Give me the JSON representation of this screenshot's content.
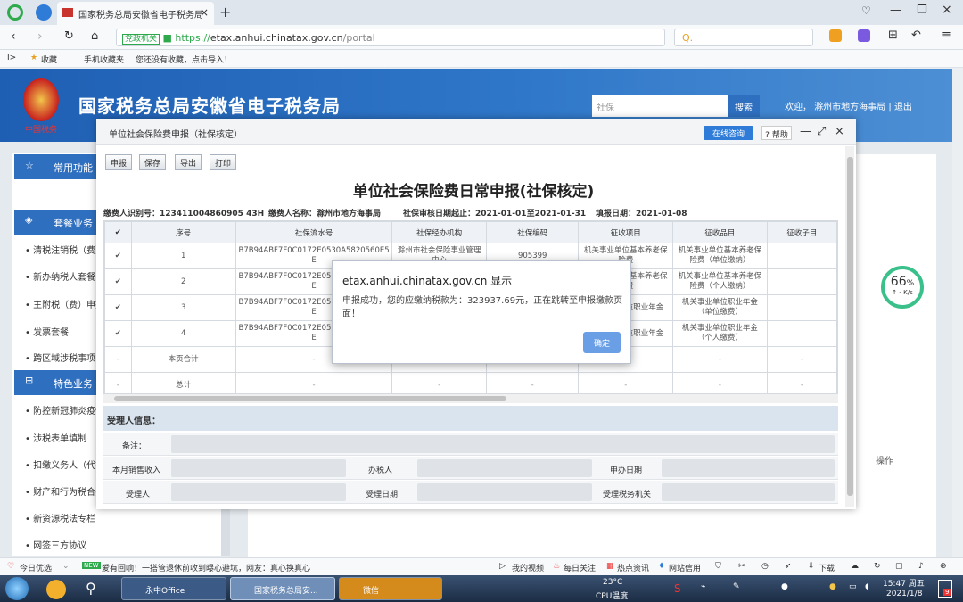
{
  "browser": {
    "tab_title": "国家税务总局安徽省电子税务局",
    "badge": "党政机关",
    "url_scheme": "https://",
    "url_host": "etax.anhui.chinatax.gov.cn",
    "url_path": "/portal",
    "search_placeholder": "Q.",
    "bookmarks": [
      "收藏",
      "手机收藏夹",
      "您还没有收藏，点击导入！"
    ]
  },
  "site": {
    "title": "国家税务总局安徽省电子税务局",
    "search_placeholder": "社保",
    "search_button": "搜索",
    "welcome": "欢迎，",
    "user": "滁州市地方海事局",
    "logout": "退出",
    "emblem_caption": "中国税务"
  },
  "sidebar": {
    "common_header": "常用功能",
    "package_header": "套餐业务",
    "package_items": [
      "清税注销税（费）",
      "新办纳税人套餐",
      "主附税（费）申报",
      "发票套餐",
      "跨区域涉税事项"
    ],
    "special_header": "特色业务",
    "special_items": [
      "防控新冠肺炎疫情",
      "涉税表单填制",
      "扣缴义务人（代扣）",
      "财产和行为税合并",
      "新资源税法专栏",
      "网签三方协议"
    ]
  },
  "main_panel": {
    "op_label": "操作"
  },
  "speed_widget": {
    "value": "66",
    "unit": "%",
    "rate": "↑ - K/s"
  },
  "modal": {
    "title": "单位社会保险费申报（社保核定）",
    "online_btn": "在线咨询",
    "help_btn": "帮助",
    "toolbar": [
      "申报",
      "保存",
      "导出",
      "打印"
    ],
    "form_title": "单位社会保险费日常申报(社保核定)",
    "info": {
      "taxpayer_id": "缴费人识别号：123411004860905 43H",
      "taxpayer_name": "缴费人名称：滁州市地方海事局",
      "period": "社保审核日期起止：2021-01-01至2021-01-31",
      "fill_date": "填报日期：2021-01-08"
    },
    "table": {
      "headers": [
        "",
        "序号",
        "社保流水号",
        "社保经办机构",
        "社保编码",
        "征收项目",
        "征收品目",
        "征收子目"
      ],
      "rows": [
        [
          "✔",
          "1",
          "B7B94ABF7F0C0172E0530A5820560E5E",
          "滁州市社会保险事业管理中心",
          "905399",
          "机关事业单位基本养老保险费",
          "机关事业单位基本养老保险费（单位缴纳）",
          ""
        ],
        [
          "✔",
          "2",
          "B7B94ABF7F0C0172E0530A5820560E5E",
          "",
          "",
          "机关事业单位基本养老保险费",
          "机关事业单位基本养老保险费（个人缴纳）",
          ""
        ],
        [
          "✔",
          "3",
          "B7B94ABF7F0C0172E0530A5820560E5E",
          "",
          "",
          "机关事业单位职业年金",
          "机关事业单位职业年金（单位缴费）",
          ""
        ],
        [
          "✔",
          "4",
          "B7B94ABF7F0C0172E0530A5820560E5E",
          "",
          "",
          "机关事业单位职业年金",
          "机关事业单位职业年金（个人缴费）",
          ""
        ],
        [
          "-",
          "本页合计",
          "-",
          "-",
          "-",
          "-",
          "-",
          "-"
        ],
        [
          "-",
          "总计",
          "-",
          "-",
          "-",
          "-",
          "-",
          "-"
        ]
      ]
    },
    "receiver": {
      "header": "受理人信息：",
      "remark": "备注：",
      "monthly_sales": "本月销售收入",
      "handler": "办税人",
      "apply_date": "申办日期",
      "acceptor": "受理人",
      "accept_date": "受理日期",
      "accept_office": "受理税务机关"
    }
  },
  "alert": {
    "title": "etax.anhui.chinatax.gov.cn 显示",
    "message": "申报成功，您的应缴纳税款为：323937.69元，正在跳转至申报缴款页面！",
    "ok": "确定"
  },
  "statusbar": {
    "left1": "今日优选",
    "news_tag": "NEW",
    "news": "爱有回响！一搭管退休前收到曝心避坑，网友：真心换真心",
    "items": [
      "我的视频",
      "每日关注",
      "热点资讯",
      "网站信用",
      "下载"
    ]
  },
  "taskbar": {
    "apps": [
      "永中Office",
      "国家税务总局安...",
      "微信"
    ],
    "temp": "23°C",
    "cpu": "CPU温度",
    "time": "15:47 周五",
    "date": "2021/1/8",
    "notif": "9"
  }
}
